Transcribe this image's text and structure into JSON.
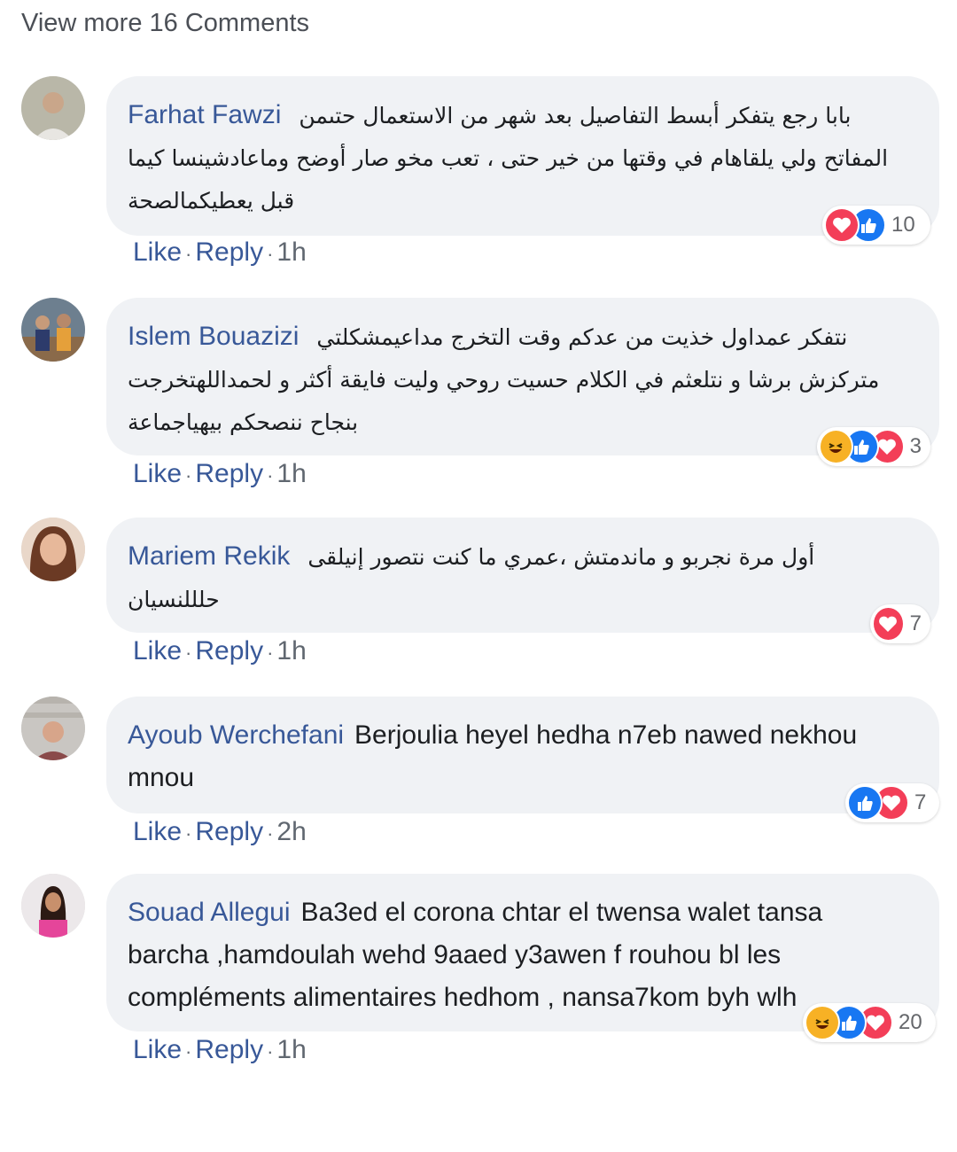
{
  "view_more_label": "View more 16 Comments",
  "colors": {
    "link": "#385898",
    "bubble": "#f0f2f5",
    "like_blue": "#1877f2",
    "love_red": "#f33e58",
    "haha_yellow": "#f7b125"
  },
  "action_labels": {
    "like": "Like",
    "reply": "Reply",
    "separator": "·"
  },
  "comments": [
    {
      "author": "Farhat Fawzi",
      "text": "بابا رجع يتفكر أبسط التفاصيل بعد شهر من الاستعمال حتىمن المفاتح ولي يلقاهام في وقتها من خير حتى ، تعب مخو صار أوضح وماعادشينسا كيما قبل يعطيكمالصحة",
      "time": "1h",
      "reaction_count": "10",
      "reaction_icons": [
        "love-icon",
        "like-icon"
      ]
    },
    {
      "author": "Islem Bouazizi",
      "text": "نتفكر عمداول خذيت من عدكم وقت التخرج مداعيمشكلتي متركزش برشا و نتلعثم في الكلام حسيت روحي وليت فايقة أكثر و لحمداللهتخرجت بنجاح ننصحكم بيهياجماعة",
      "time": "1h",
      "reaction_count": "3",
      "reaction_icons": [
        "haha-icon",
        "like-icon",
        "love-icon"
      ]
    },
    {
      "author": "Mariem Rekik",
      "text": "أول مرة نجربو و ماندمتش ،عمري ما كنت نتصور إنيلقى حلللنسيان",
      "time": "1h",
      "reaction_count": "7",
      "reaction_icons": [
        "love-icon"
      ]
    },
    {
      "author": "Ayoub Werchefani",
      "text": "Berjoulia heyel hedha n7eb nawed nekhou mnou",
      "time": "2h",
      "reaction_count": "7",
      "reaction_icons": [
        "like-icon",
        "love-icon"
      ]
    },
    {
      "author": "Souad Allegui",
      "text": "Ba3ed el corona chtar el twensa walet tansa barcha ,hamdoulah wehd 9aaed y3awen f rouhou bl les compléments alimentaires hedhom , nansa7kom byh wlh",
      "time": "1h",
      "reaction_count": "20",
      "reaction_icons": [
        "haha-icon",
        "like-icon",
        "love-icon"
      ]
    }
  ]
}
